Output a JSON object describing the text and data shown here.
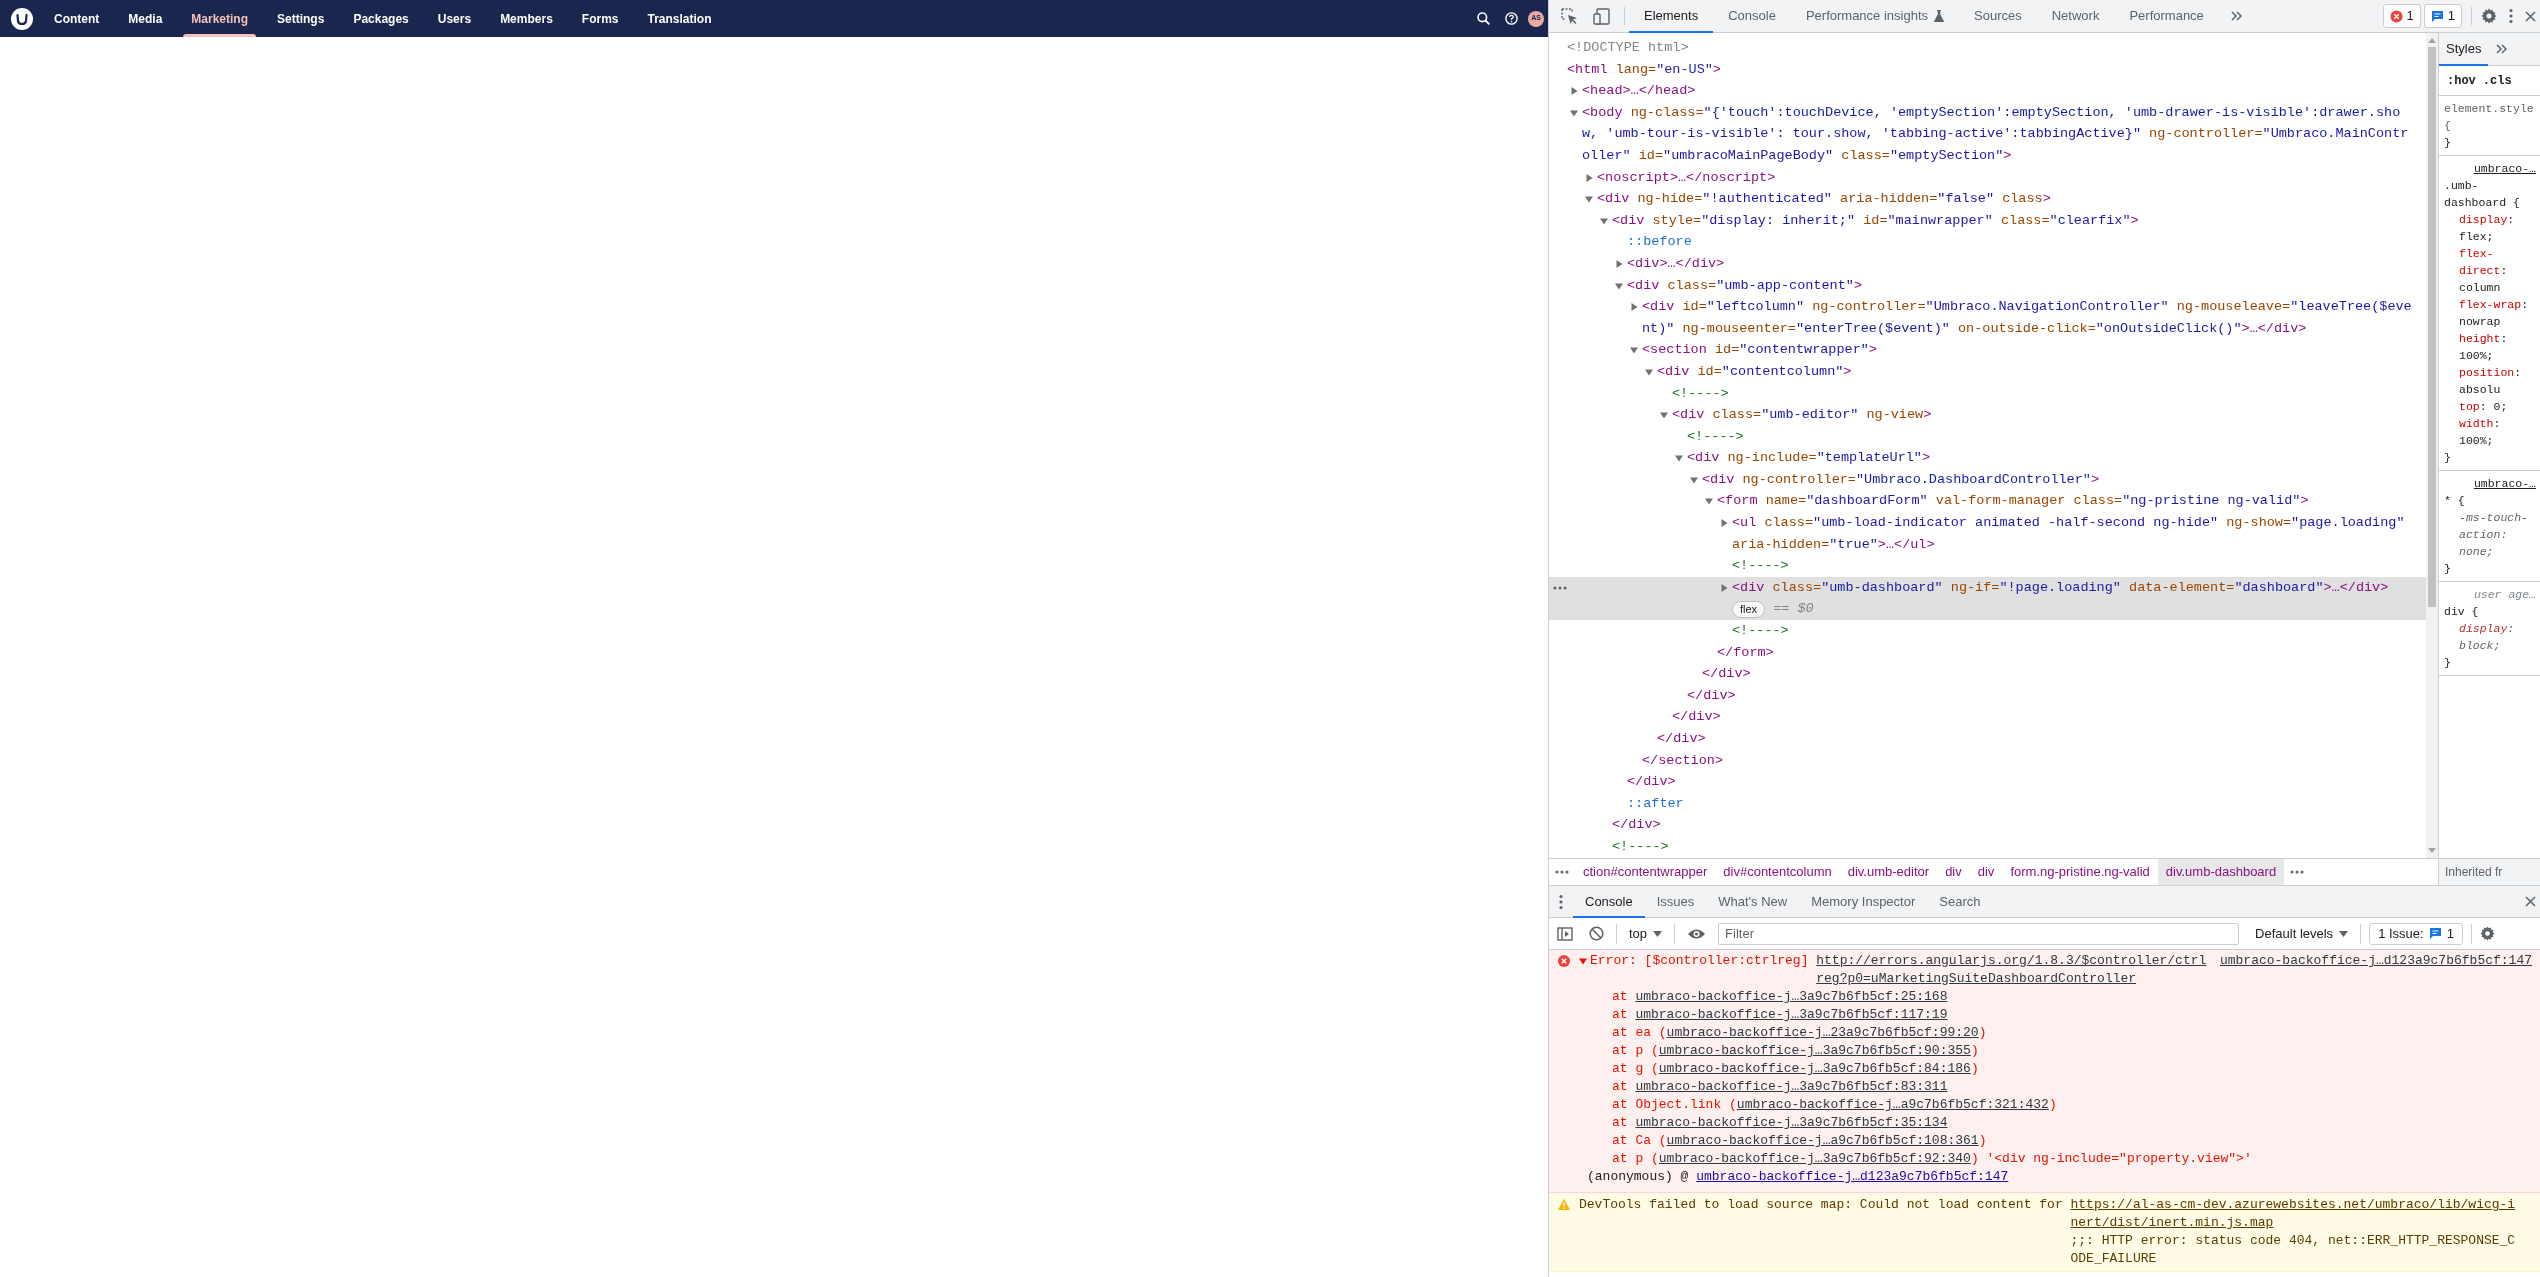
{
  "app": {
    "nav": {
      "items": [
        {
          "label": "Content",
          "selected": false
        },
        {
          "label": "Media",
          "selected": false
        },
        {
          "label": "Marketing",
          "selected": true
        },
        {
          "label": "Settings",
          "selected": false
        },
        {
          "label": "Packages",
          "selected": false
        },
        {
          "label": "Users",
          "selected": false
        },
        {
          "label": "Members",
          "selected": false
        },
        {
          "label": "Forms",
          "selected": false
        },
        {
          "label": "Translation",
          "selected": false
        }
      ],
      "avatar": "AS"
    }
  },
  "devtools": {
    "tabs": [
      {
        "label": "Elements",
        "selected": true,
        "experimental": false
      },
      {
        "label": "Console",
        "selected": false,
        "experimental": false
      },
      {
        "label": "Performance insights",
        "selected": false,
        "experimental": true
      },
      {
        "label": "Sources",
        "selected": false,
        "experimental": false
      },
      {
        "label": "Network",
        "selected": false,
        "experimental": false
      },
      {
        "label": "Performance",
        "selected": false,
        "experimental": false
      }
    ],
    "error_count": "1",
    "message_count": "1",
    "dom_tree": [
      {
        "kind": "doctype",
        "text": "<!DOCTYPE html>",
        "selected": false
      },
      {
        "kind": "element",
        "text": "<html lang=\"en-US\">",
        "selected": false,
        "children": [
          {
            "kind": "element",
            "text": "<head>…</head>",
            "expanded": false,
            "selected": false
          },
          {
            "kind": "element",
            "text": "<body ng-class=\"{'touch':touchDevice, 'emptySection':emptySection, 'umb-drawer-is-visible':drawer.show, 'umb-tour-is-visible': tour.show, 'tabbing-active':tabbingActive}\" ng-controller=\"Umbraco.MainController\" id=\"umbracoMainPageBody\" class=\"emptySection\">",
            "expanded": true,
            "selected": false,
            "children": [
              {
                "kind": "element",
                "text": "<noscript>…</noscript>",
                "expanded": false,
                "selected": false
              },
              {
                "kind": "element",
                "text": "<div ng-hide=\"!authenticated\" aria-hidden=\"false\" class>",
                "expanded": true,
                "selected": false,
                "children": [
                  {
                    "kind": "element",
                    "text": "<div style=\"display: inherit;\" id=\"mainwrapper\" class=\"clearfix\">",
                    "expanded": true,
                    "selected": false,
                    "children": [
                      {
                        "kind": "pseudo",
                        "text": "::before",
                        "selected": false
                      },
                      {
                        "kind": "element",
                        "text": "<div>…</div>",
                        "expanded": false,
                        "selected": false
                      },
                      {
                        "kind": "element",
                        "text": "<div class=\"umb-app-content\">",
                        "expanded": true,
                        "selected": false,
                        "children": [
                          {
                            "kind": "element",
                            "text": "<div id=\"leftcolumn\" ng-controller=\"Umbraco.NavigationController\" ng-mouseleave=\"leaveTree($event)\" ng-mouseenter=\"enterTree($event)\" on-outside-click=\"onOutsideClick()\">…</div>",
                            "expanded": false,
                            "selected": false
                          },
                          {
                            "kind": "element",
                            "text": "<section id=\"contentwrapper\">",
                            "expanded": true,
                            "selected": false,
                            "children": [
                              {
                                "kind": "element",
                                "text": "<div id=\"contentcolumn\">",
                                "expanded": true,
                                "selected": false,
                                "children": [
                                  {
                                    "kind": "comment",
                                    "text": "<!---->",
                                    "selected": false
                                  },
                                  {
                                    "kind": "element",
                                    "text": "<div class=\"umb-editor\" ng-view>",
                                    "expanded": true,
                                    "selected": false,
                                    "children": [
                                      {
                                        "kind": "comment",
                                        "text": "<!---->",
                                        "selected": false
                                      },
                                      {
                                        "kind": "element",
                                        "text": "<div ng-include=\"templateUrl\">",
                                        "expanded": true,
                                        "selected": false,
                                        "children": [
                                          {
                                            "kind": "element",
                                            "text": "<div ng-controller=\"Umbraco.DashboardController\">",
                                            "expanded": true,
                                            "selected": false,
                                            "children": [
                                              {
                                                "kind": "element",
                                                "text": "<form name=\"dashboardForm\" val-form-manager class=\"ng-pristine ng-valid\">",
                                                "expanded": true,
                                                "selected": false,
                                                "children": [
                                                  {
                                                    "kind": "element",
                                                    "text": "<ul class=\"umb-load-indicator animated -half-second ng-hide\" ng-show=\"page.loading\" aria-hidden=\"true\">…</ul>",
                                                    "expanded": false,
                                                    "selected": false
                                                  },
                                                  {
                                                    "kind": "comment",
                                                    "text": "<!---->",
                                                    "selected": false
                                                  },
                                                  {
                                                    "kind": "element",
                                                    "text": "<div class=\"umb-dashboard\" ng-if=\"!page.loading\" data-element=\"dashboard\">…</div>",
                                                    "expanded": false,
                                                    "selected": true,
                                                    "badge": "flex",
                                                    "suffix": "== $0"
                                                  },
                                                  {
                                                    "kind": "comment",
                                                    "text": "<!---->",
                                                    "selected": false
                                                  }
                                                ],
                                                "close": "</form>"
                                              }
                                            ],
                                            "close": "</div>"
                                          }
                                        ],
                                        "close": "</div>"
                                      }
                                    ],
                                    "close": "</div>"
                                  }
                                ],
                                "close": "</div>"
                              }
                            ],
                            "close": "</section>"
                          }
                        ],
                        "close": "</div>"
                      },
                      {
                        "kind": "pseudo",
                        "text": "::after",
                        "selected": false
                      }
                    ],
                    "close": "</div>"
                  },
                  {
                    "kind": "comment",
                    "text": "<!---->",
                    "selected": false
                  }
                ]
              }
            ]
          }
        ]
      }
    ],
    "breadcrumbs": [
      {
        "label": "ction#contentwrapper",
        "selected": false
      },
      {
        "label": "div#contentcolumn",
        "selected": false
      },
      {
        "label": "div.umb-editor",
        "selected": false
      },
      {
        "label": "div",
        "selected": false
      },
      {
        "label": "div",
        "selected": false
      },
      {
        "label": "form.ng-pristine.ng-valid",
        "selected": false
      },
      {
        "label": "div.umb-dashboard",
        "selected": true
      }
    ],
    "styles": {
      "tabs": [
        {
          "label": "Styles",
          "selected": true
        }
      ],
      "filters": [
        ":hov",
        ".cls"
      ],
      "rules": [
        {
          "kind": "inline",
          "selector": "element.style {",
          "end": "}"
        },
        {
          "source": "umbraco-…",
          "kind": "file",
          "selector": ".umb-dashboard {",
          "end": "}",
          "properties": [
            {
              "name": "display",
              "value": ": flex;",
              "overridden": false
            },
            {
              "name": "flex-direct",
              "value": ": column",
              "overridden": false
            },
            {
              "name": "flex-wrap",
              "value": ": nowrap",
              "overridden": false
            },
            {
              "name": "height",
              "value": ": 100%;",
              "overridden": false
            },
            {
              "name": "position",
              "value": ": absolu",
              "overridden": false
            },
            {
              "name": "top",
              "value": ": 0;",
              "overridden": false
            },
            {
              "name": "width",
              "value": ": 100%;",
              "overridden": false
            }
          ]
        },
        {
          "source": "umbraco-…",
          "kind": "file",
          "selector": "* {",
          "end": "}",
          "properties": [
            {
              "name": "-ms-touch-action",
              "value": ": none;",
              "overridden": true
            }
          ]
        },
        {
          "source": "user age…",
          "kind": "user-agent",
          "selector": "div {",
          "end": "}",
          "properties": [
            {
              "name": "display",
              "value": ": block;",
              "overridden": true
            }
          ]
        }
      ],
      "inherited": "Inherited fr"
    },
    "drawer": {
      "tabs": [
        {
          "label": "Console",
          "selected": true
        },
        {
          "label": "Issues",
          "selected": false
        },
        {
          "label": "What's New",
          "selected": false
        },
        {
          "label": "Memory Inspector",
          "selected": false
        },
        {
          "label": "Search",
          "selected": false
        }
      ],
      "context": "top",
      "filter_placeholder": "Filter",
      "levels": "Default levels",
      "issues_label": "1 Issue:",
      "issues_count": "1",
      "messages": [
        {
          "kind": "error",
          "expanded": true,
          "text": "Error: [$controller:ctrlreg] ",
          "link": "http://errors.angularjs.org/1.8.3/$controller/ctrlreg?p0=uMarketingSuiteDashboardController",
          "source": "umbraco-backoffice-j…d123a9c7b6fb5cf:147",
          "stack": [
            {
              "before": "at ",
              "link": "umbraco-backoffice-j…3a9c7b6fb5cf:25:168"
            },
            {
              "before": "at ",
              "link": "umbraco-backoffice-j…3a9c7b6fb5cf:117:19"
            },
            {
              "before": "at ea (",
              "link": "umbraco-backoffice-j…23a9c7b6fb5cf:99:20",
              "after": ")"
            },
            {
              "before": "at p (",
              "link": "umbraco-backoffice-j…3a9c7b6fb5cf:90:355",
              "after": ")"
            },
            {
              "before": "at g (",
              "link": "umbraco-backoffice-j…3a9c7b6fb5cf:84:186",
              "after": ")"
            },
            {
              "before": "at ",
              "link": "umbraco-backoffice-j…3a9c7b6fb5cf:83:311"
            },
            {
              "before": "at Object.link (",
              "link": "umbraco-backoffice-j…a9c7b6fb5cf:321:432",
              "after": ")"
            },
            {
              "before": "at ",
              "link": "umbraco-backoffice-j…3a9c7b6fb5cf:35:134"
            },
            {
              "before": "at Ca (",
              "link": "umbraco-backoffice-j…a9c7b6fb5cf:108:361",
              "after": ")"
            },
            {
              "before": "at p (",
              "link": "umbraco-backoffice-j…3a9c7b6fb5cf:92:340",
              "after": ") '<div ng-include=\"property.view\">'"
            }
          ],
          "origin": {
            "text": "(anonymous) @ ",
            "link": "umbraco-backoffice-j…d123a9c7b6fb5cf:147"
          }
        },
        {
          "kind": "warning",
          "text": "DevTools failed to load source map: Could not load content for ",
          "link": "https://al-as-cm-dev.azurewebsites.net/umbraco/lib/wicg-inert/dist/inert.min.js.map",
          "after": ";;: HTTP error: status code 404, net::ERR_HTTP_RESPONSE_CODE_FAILURE"
        }
      ]
    }
  }
}
